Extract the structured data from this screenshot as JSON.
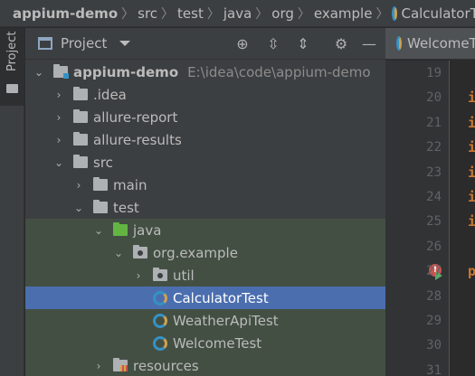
{
  "breadcrumb": [
    "appium-demo",
    "src",
    "test",
    "java",
    "org",
    "example",
    "CalculatorTest"
  ],
  "strip": {
    "label": "Project"
  },
  "panel": {
    "title": "Project",
    "tools": [
      "crosshair-icon",
      "expand-all-icon",
      "collapse-all-icon",
      "gear-icon",
      "minimize-icon"
    ]
  },
  "tree": [
    {
      "label": "appium-demo",
      "path": "E:\\idea\\code\\appium-demo",
      "depth": 0,
      "arrow": "down",
      "icon": "module-folder-icon",
      "bold": true
    },
    {
      "label": ".idea",
      "depth": 1,
      "arrow": "right",
      "icon": "folder-icon"
    },
    {
      "label": "allure-report",
      "depth": 1,
      "arrow": "right",
      "icon": "folder-icon"
    },
    {
      "label": "allure-results",
      "depth": 1,
      "arrow": "right",
      "icon": "folder-icon"
    },
    {
      "label": "src",
      "depth": 1,
      "arrow": "down",
      "icon": "folder-icon"
    },
    {
      "label": "main",
      "depth": 2,
      "arrow": "right",
      "icon": "folder-icon"
    },
    {
      "label": "test",
      "depth": 2,
      "arrow": "down",
      "icon": "folder-icon"
    },
    {
      "label": "java",
      "depth": 3,
      "arrow": "down",
      "icon": "test-source-folder-icon",
      "tint": true
    },
    {
      "label": "org.example",
      "depth": 4,
      "arrow": "down",
      "icon": "package-icon",
      "tint": true
    },
    {
      "label": "util",
      "depth": 5,
      "arrow": "right",
      "icon": "package-icon",
      "tint": true
    },
    {
      "label": "CalculatorTest",
      "depth": 5,
      "arrow": "",
      "icon": "class-icon",
      "selected": true
    },
    {
      "label": "WeatherApiTest",
      "depth": 5,
      "arrow": "",
      "icon": "class-icon",
      "tint": true
    },
    {
      "label": "WelcomeTest",
      "depth": 5,
      "arrow": "",
      "icon": "class-icon",
      "tint": true
    },
    {
      "label": "resources",
      "depth": 3,
      "arrow": "right",
      "icon": "test-resources-folder-icon",
      "tint": true
    }
  ],
  "editor": {
    "tab_label": "WelcomeTest",
    "line_numbers": [
      "19",
      "20",
      "21",
      "22",
      "23",
      "24",
      "25",
      "26",
      "27",
      "28",
      "29",
      "30",
      "31"
    ],
    "code_lines": [
      {
        "line": "20",
        "text": "i"
      },
      {
        "line": "21",
        "text": "i"
      },
      {
        "line": "22",
        "text": "i"
      },
      {
        "line": "23",
        "text": "i"
      },
      {
        "line": "24",
        "text": "i"
      },
      {
        "line": "25",
        "text": "i"
      },
      {
        "line": "27",
        "text": "p"
      }
    ]
  },
  "colors": {
    "selection": "#4b6eaf",
    "test_tint": "#434f43",
    "test_folder_green": "#62b543",
    "keyword": "#cc7832"
  }
}
